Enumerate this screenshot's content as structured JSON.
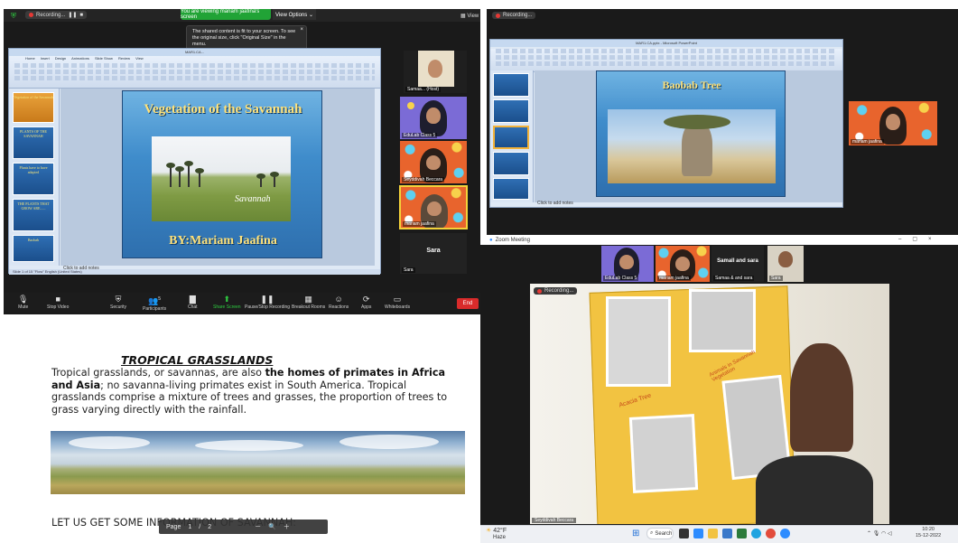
{
  "zoom_left": {
    "recording_label": "Recording...",
    "pause_icon": "pause-icon",
    "stop_icon": "stop-icon",
    "banner": "You are viewing mariam jaafina's screen",
    "view_options": "View Options ⌄",
    "view_label": "View",
    "tooltip": "The shared content is fit to your screen. To see the original size, click \"Original Size\" in the menu.",
    "ppt_title": "MAR1.CA...",
    "ribbon_tabs": [
      "Home",
      "Insert",
      "Design",
      "Animations",
      "Slide Show",
      "Review",
      "View"
    ],
    "slide_title": "Vegetation of the Savannah",
    "slide_caption": "Savannah",
    "slide_author": "BY:Mariam Jaafina",
    "click_notes": "Click to add notes",
    "status": "Slide 1 of 15    \"Flow\"    English (United States)",
    "thumbnails": [
      "Vegetation of the Savannah",
      "",
      "PLANTS OF THE SAVANNAH",
      "Plants have to have adapted",
      "THE PLANTS THAT GROW ARE......",
      "Baobab"
    ],
    "participants": [
      {
        "name": "Samaa... (Host)"
      },
      {
        "name": "EduLab Class 5"
      },
      {
        "name": "Seyddivah Beccara"
      },
      {
        "name": "mariam jaafina"
      },
      {
        "name": "Sara",
        "label": "Sara"
      }
    ],
    "toolbar": [
      {
        "label": "Mute",
        "icon": "microphone-icon"
      },
      {
        "label": "Stop Video",
        "icon": "video-camera-icon"
      },
      {
        "label": "Security",
        "icon": "shield-icon"
      },
      {
        "label": "Participants",
        "icon": "participants-icon",
        "count": "5"
      },
      {
        "label": "Chat",
        "icon": "chat-icon"
      },
      {
        "label": "Share Screen",
        "icon": "share-screen-icon"
      },
      {
        "label": "Pause/Stop Recording",
        "icon": "pause-recording-icon"
      },
      {
        "label": "Breakout Rooms",
        "icon": "breakout-rooms-icon"
      },
      {
        "label": "Reactions",
        "icon": "reactions-icon"
      },
      {
        "label": "Apps",
        "icon": "apps-icon"
      },
      {
        "label": "Whiteboards",
        "icon": "whiteboard-icon"
      }
    ],
    "end_label": "End"
  },
  "document": {
    "heading": "TROPICAL GRASSLANDS",
    "para_1": "Tropical grasslands, or savannas, are also ",
    "para_bold": "the homes of primates in Africa and Asia",
    "para_2": "; no savanna-living primates exist in South America. Tropical grasslands comprise a mixture of trees and grasses, the proportion of trees to grass varying directly with the rainfall.",
    "bottom_text": "LET US GET SOME INFORMATION OF SAVANNAH:",
    "page_label": "Page",
    "page_current": "1",
    "page_sep": "/",
    "page_total": "2"
  },
  "zoom_topright": {
    "recording_label": "Recording...",
    "ppt_title": "MAR1.CA.pptx - Microsoft PowerPoint",
    "slide_title": "Baobab Tree",
    "click_notes": "Click to add notes",
    "participant_name": "mariam jaafina"
  },
  "zoom_meeting": {
    "title": "Zoom Meeting",
    "recording_label": "Recording...",
    "participants": [
      {
        "name": "EduLab Class 5"
      },
      {
        "name": "mariam jaafina"
      },
      {
        "name": "Samaa & and sara",
        "label": "Samall and sara"
      },
      {
        "name": "Sara"
      }
    ],
    "cam_name": "Seyddivah Beccara",
    "board_text_1": "Animals in Savannah Vegetation",
    "board_text_2": "Acacia Tree"
  },
  "taskbar": {
    "weather_temp": "42°F",
    "weather_desc": "Haze",
    "search_label": "Search",
    "time": "10:20",
    "date": "15-12-2022"
  }
}
